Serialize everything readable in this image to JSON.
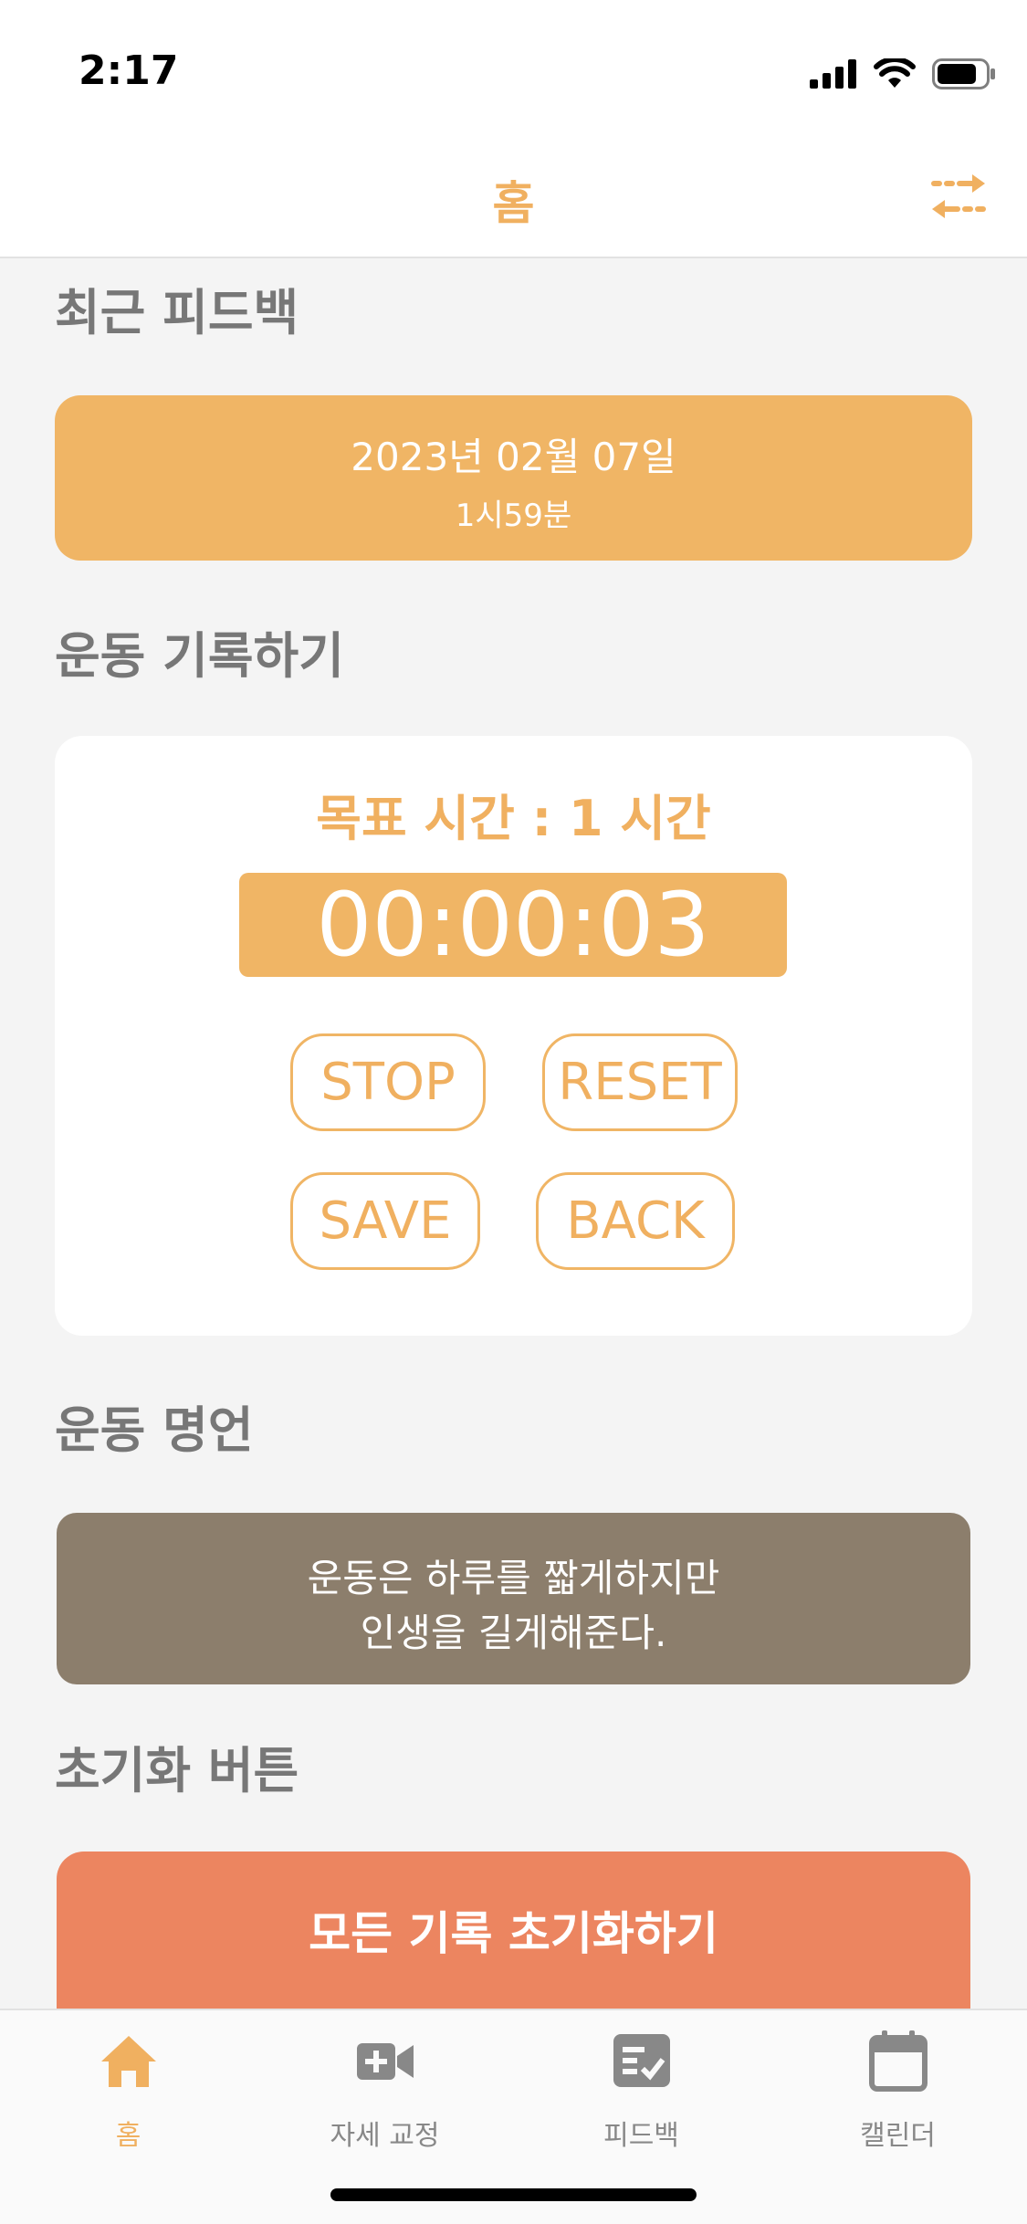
{
  "status_bar": {
    "time": "2:17"
  },
  "nav": {
    "title": "홈"
  },
  "colors": {
    "accent": "#F0B565",
    "quote_bg": "#8C7E6C",
    "danger": "#EC8560",
    "section_text": "#777777"
  },
  "recent_feedback": {
    "section_title": "최근 피드백",
    "date": "2023년 02월 07일",
    "duration": "1시59분"
  },
  "workout_record": {
    "section_title": "운동 기록하기",
    "goal_label": "목표 시간 : 1 시간",
    "timer": "00:00:03",
    "buttons": {
      "stop": "STOP",
      "reset": "RESET",
      "save": "SAVE",
      "back": "BACK"
    }
  },
  "quote": {
    "section_title": "운동 명언",
    "line1": "운동은 하루를 짧게하지만",
    "line2": "인생을 길게해준다."
  },
  "reset_section": {
    "section_title": "초기화 버튼",
    "button_label": "모든 기록 초기화하기"
  },
  "tabs": [
    {
      "label": "홈",
      "icon": "house-icon",
      "active": true
    },
    {
      "label": "자세 교정",
      "icon": "video-plus-icon",
      "active": false
    },
    {
      "label": "피드백",
      "icon": "checklist-icon",
      "active": false
    },
    {
      "label": "캘린더",
      "icon": "calendar-icon",
      "active": false
    }
  ]
}
